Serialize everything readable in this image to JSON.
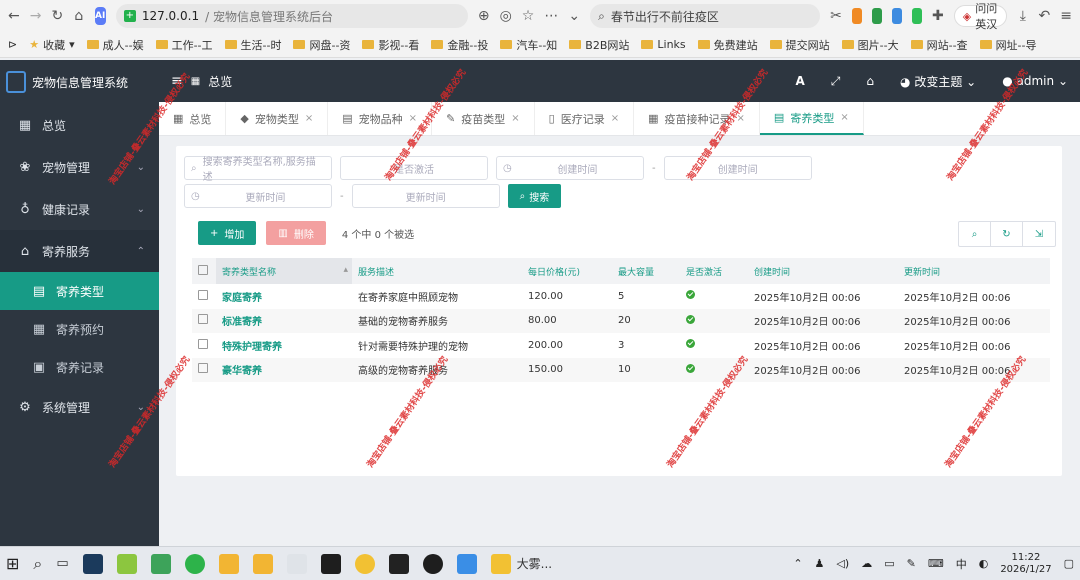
{
  "browser": {
    "url": "127.0.0.1",
    "page_title": "/ 宠物信息管理系统后台",
    "search_text": "春节出行不前往疫区",
    "translate_label": "问问英汉",
    "bookmarks": [
      {
        "label": "收藏"
      },
      {
        "label": "成人--娱"
      },
      {
        "label": "工作--工"
      },
      {
        "label": "生活--时"
      },
      {
        "label": "网盘--资"
      },
      {
        "label": "影视--看"
      },
      {
        "label": "金融--投"
      },
      {
        "label": "汽车--知"
      },
      {
        "label": "B2B网站"
      },
      {
        "label": "Links"
      },
      {
        "label": "免费建站"
      },
      {
        "label": "提交网站"
      },
      {
        "label": "图片--大"
      },
      {
        "label": "网站--查"
      },
      {
        "label": "网址--导"
      }
    ]
  },
  "app": {
    "name": "宠物信息管理系统",
    "topbar": {
      "home_label": "总览",
      "theme_label": "改变主题",
      "user_label": "admin"
    },
    "sidebar": [
      {
        "label": "总览",
        "icon": "dashboard-icon"
      },
      {
        "label": "宠物管理",
        "icon": "paw-icon",
        "has_children": true
      },
      {
        "label": "健康记录",
        "icon": "stethoscope-icon",
        "has_children": true
      },
      {
        "label": "寄养服务",
        "icon": "home-icon",
        "has_children": true,
        "open": true,
        "children": [
          {
            "label": "寄养类型",
            "icon": "building-icon",
            "active": true
          },
          {
            "label": "寄养预约",
            "icon": "calendar-icon"
          },
          {
            "label": "寄养记录",
            "icon": "clipboard-icon"
          }
        ]
      },
      {
        "label": "系统管理",
        "icon": "gear-icon",
        "has_children": true
      }
    ],
    "tabs": [
      {
        "label": "总览",
        "closable": false
      },
      {
        "label": "宠物类型",
        "closable": true
      },
      {
        "label": "宠物品种",
        "closable": true
      },
      {
        "label": "疫苗类型",
        "closable": true
      },
      {
        "label": "医疗记录",
        "closable": true
      },
      {
        "label": "疫苗接种记录",
        "closable": true
      },
      {
        "label": "寄养类型",
        "closable": true,
        "active": true
      }
    ],
    "filters": {
      "keyword_placeholder": "搜索寄养类型名称,服务描述",
      "active_placeholder": "是否激活",
      "created_start_placeholder": "创建时间",
      "created_end_placeholder": "创建时间",
      "updated_start_placeholder": "更新时间",
      "updated_end_placeholder": "更新时间",
      "search_label": "搜索"
    },
    "toolbar": {
      "add_label": "增加",
      "delete_label": "删除",
      "selection_info": "4 个中 0 个被选"
    },
    "table": {
      "columns": [
        "寄养类型名称",
        "服务描述",
        "每日价格(元)",
        "最大容量",
        "是否激活",
        "创建时间",
        "更新时间"
      ],
      "rows": [
        {
          "name": "家庭寄养",
          "desc": "在寄养家庭中照顾宠物",
          "price": "120.00",
          "capacity": "5",
          "active": true,
          "created": "2025年10月2日 00:06",
          "updated": "2025年10月2日 00:06"
        },
        {
          "name": "标准寄养",
          "desc": "基础的宠物寄养服务",
          "price": "80.00",
          "capacity": "20",
          "active": true,
          "created": "2025年10月2日 00:06",
          "updated": "2025年10月2日 00:06"
        },
        {
          "name": "特殊护理寄养",
          "desc": "针对需要特殊护理的宠物",
          "price": "200.00",
          "capacity": "3",
          "active": true,
          "created": "2025年10月2日 00:06",
          "updated": "2025年10月2日 00:06"
        },
        {
          "name": "豪华寄养",
          "desc": "高级的宠物寄养服务",
          "price": "150.00",
          "capacity": "10",
          "active": true,
          "created": "2025年10月2日 00:06",
          "updated": "2025年10月2日 00:06"
        }
      ]
    }
  },
  "watermark_text": "淘宝店铺-叠云素材科技-侵权必究",
  "taskbar": {
    "app_label": "大雾...",
    "ime_label": "中",
    "time": "11:22",
    "date": "2026/1/27"
  }
}
